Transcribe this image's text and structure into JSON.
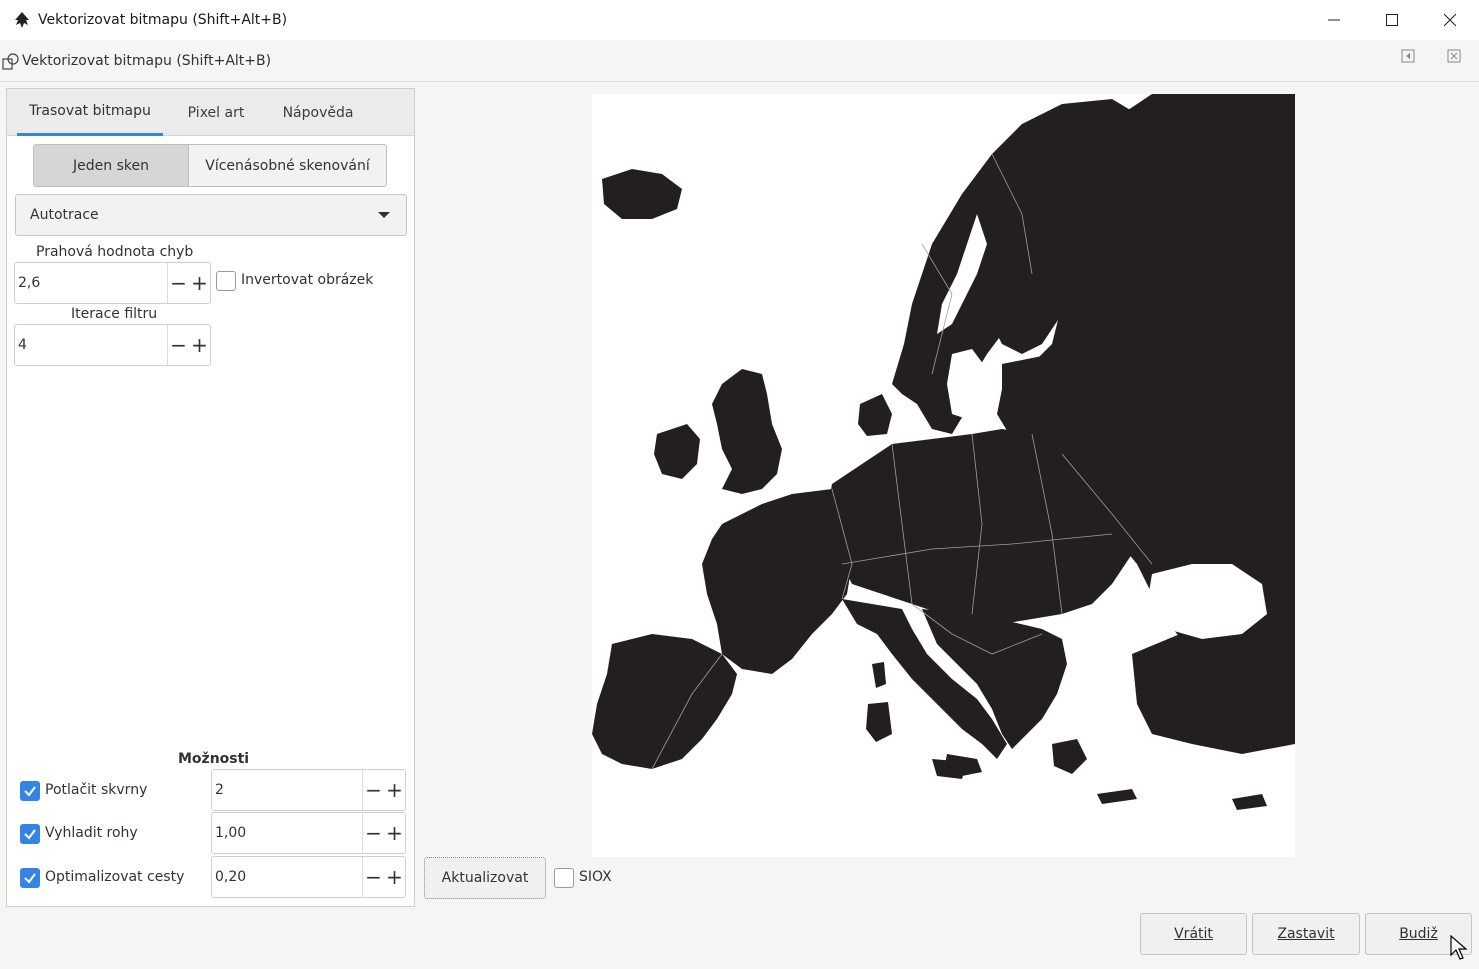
{
  "window": {
    "title": "Vektorizovat bitmapu (Shift+Alt+B)",
    "app_icon": "inkscape-icon",
    "controls": [
      "minimize-icon",
      "maximize-icon",
      "close-icon"
    ]
  },
  "dock": {
    "title": "Vektorizovat bitmapu (Shift+Alt+B)",
    "icon": "trace-bitmap-icon"
  },
  "tabs": [
    {
      "label": "Trasovat bitmapu",
      "active": true
    },
    {
      "label": "Pixel art",
      "active": false
    },
    {
      "label": "Nápověda",
      "active": false
    }
  ],
  "scan_mode": {
    "single": "Jeden sken",
    "multi": "Vícenásobné skenování"
  },
  "method": {
    "selected": "Autotrace"
  },
  "error_threshold": {
    "label": "Prahová hodnota chyb",
    "value": "2,6"
  },
  "invert": {
    "label": "Invertovat obrázek",
    "checked": false
  },
  "filter_iterations": {
    "label": "Iterace filtru",
    "value": "4"
  },
  "options": {
    "title": "Možnosti",
    "items": [
      {
        "label": "Potlačit skvrny",
        "checked": true,
        "value": "2"
      },
      {
        "label": "Vyhladit rohy",
        "checked": true,
        "value": "1,00"
      },
      {
        "label": "Optimalizovat cesty",
        "checked": true,
        "value": "0,20"
      }
    ]
  },
  "preview": {
    "update_label": "Aktualizovat",
    "siox_label": "SIOX",
    "siox_checked": false
  },
  "footer": {
    "revert": "Vrátit",
    "stop": "Zastavit",
    "apply": "Budiž"
  },
  "colors": {
    "accent": "#3584e4",
    "map_fill": "#231f20"
  }
}
